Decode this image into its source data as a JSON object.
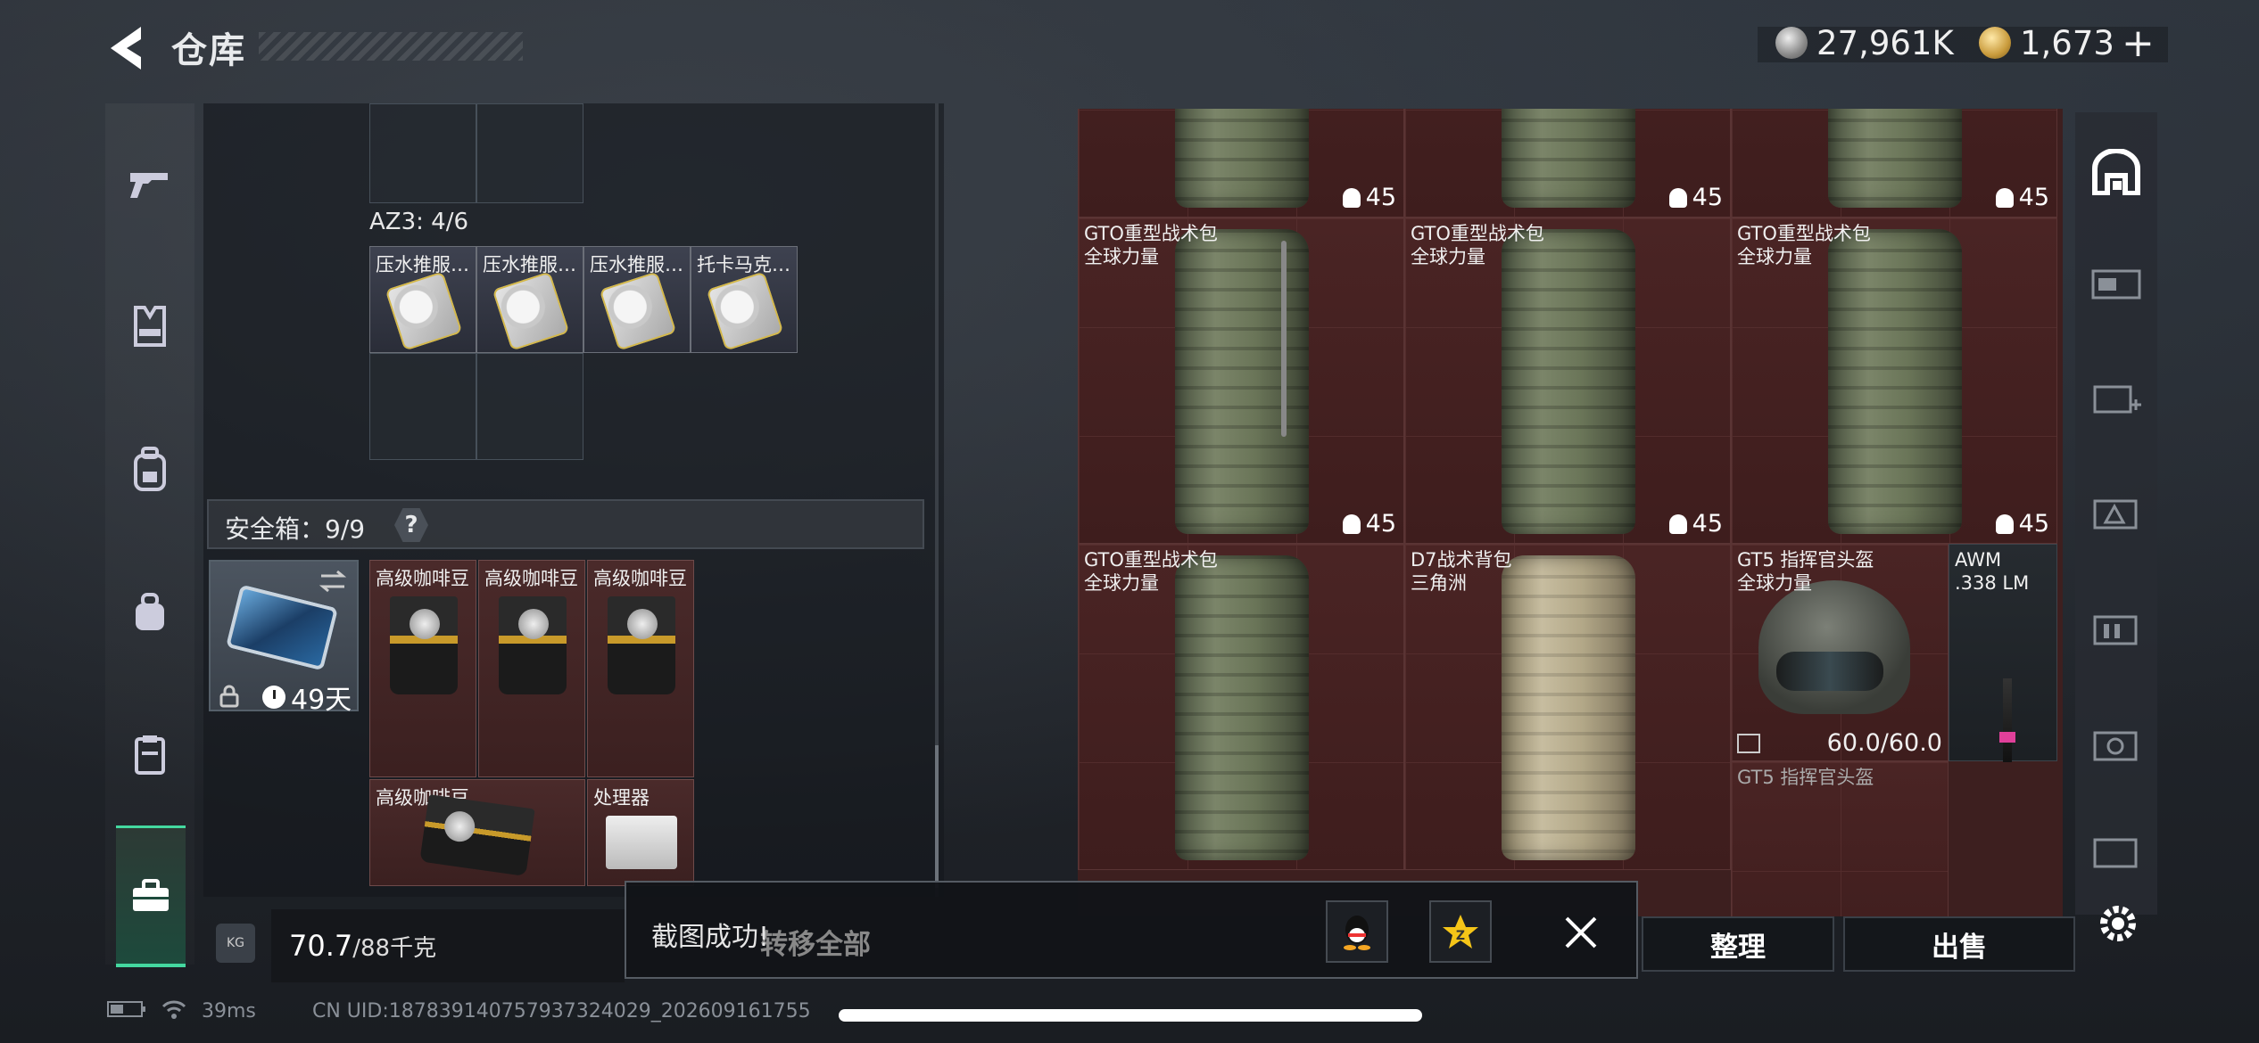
{
  "header": {
    "title": "仓库",
    "currency_silver": "27,961K",
    "currency_gold": "1,673"
  },
  "left_nav": {
    "items": [
      "gun-icon",
      "vest-icon",
      "backpack-icon",
      "bag-icon",
      "clipboard-icon",
      "toolbox-icon"
    ]
  },
  "storage": {
    "az3_label": "AZ3: 4/6",
    "az3_items": [
      "压水推服…",
      "压水推服…",
      "压水推服…",
      "托卡马克…"
    ],
    "safebox_label": "安全箱：9/9",
    "help": "?",
    "safebox_timer": "49天",
    "safebox_items": [
      "高级咖啡豆",
      "高级咖啡豆",
      "高级咖啡豆",
      "高级咖啡豆",
      "处理器"
    ],
    "weight_value": "70.7",
    "weight_max": "/88千克",
    "kg_badge": "KG"
  },
  "loot": {
    "row1_counts": [
      "45",
      "45",
      "45"
    ],
    "row2": [
      {
        "name": "GTO重型战术包",
        "sub": "全球力量",
        "count": "45"
      },
      {
        "name": "GTO重型战术包",
        "sub": "全球力量",
        "count": "45"
      },
      {
        "name": "GTO重型战术包",
        "sub": "全球力量",
        "count": "45"
      }
    ],
    "row3": [
      {
        "name": "GTO重型战术包",
        "sub": "全球力量"
      },
      {
        "name": "D7战术背包",
        "sub": "三角洲"
      }
    ],
    "helmet": {
      "name": "GT5 指挥官头盔",
      "sub": "全球力量",
      "durability": "60.0/60.0",
      "ghost": "GT5 指挥官头盔"
    },
    "awm": {
      "name": "AWM",
      "sub": ".338 LM"
    }
  },
  "buttons": {
    "transfer_all": "转移全部",
    "sort": "整理",
    "sell": "出售"
  },
  "toast": {
    "message": "截图成功!"
  },
  "status": {
    "ping": "39ms",
    "uid": "CN UID:187839140757937324029_202609161755"
  },
  "colors": {
    "accent": "#44d8a0",
    "loot_bg": "#3d1f1f"
  }
}
